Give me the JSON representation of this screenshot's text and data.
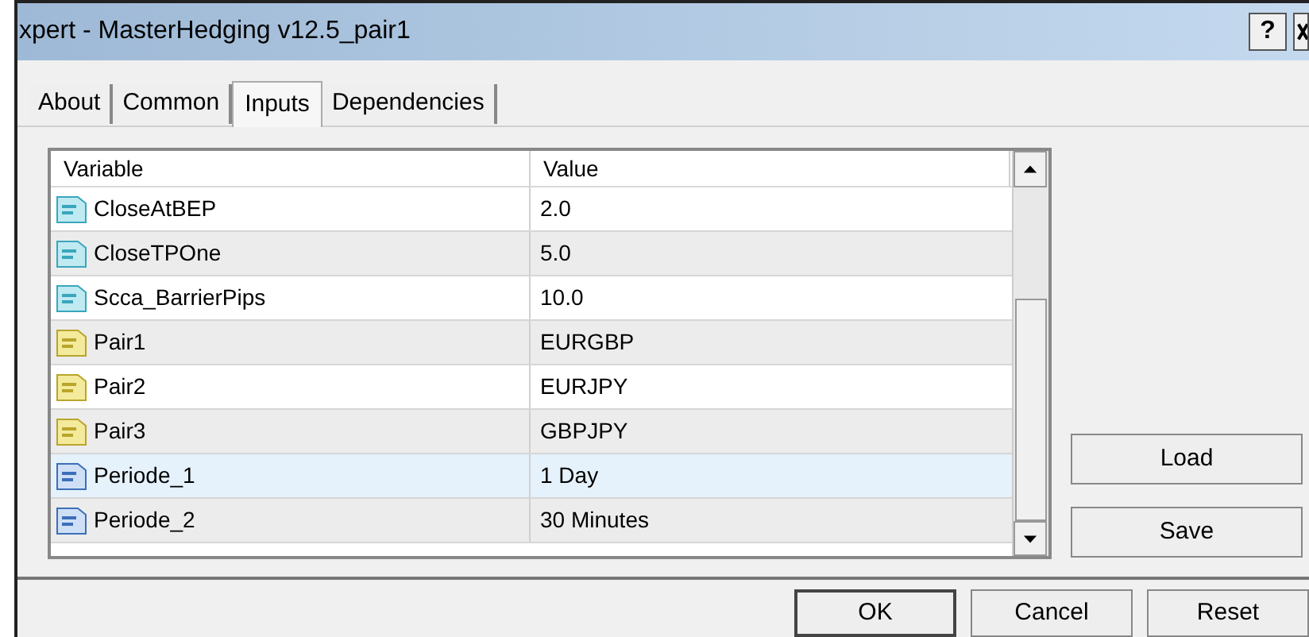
{
  "window": {
    "title": "xpert - MasterHedging v12.5_pair1",
    "help_button": "?"
  },
  "tabs": [
    {
      "label": "About",
      "selected": false
    },
    {
      "label": "Common",
      "selected": false
    },
    {
      "label": "Inputs",
      "selected": true
    },
    {
      "label": "Dependencies",
      "selected": false
    }
  ],
  "table": {
    "columns": [
      "Variable",
      "Value"
    ],
    "rows": [
      {
        "kind": "double",
        "variable": "CloseAtBEP",
        "value": "2.0",
        "selected": false
      },
      {
        "kind": "double",
        "variable": "CloseTPOne",
        "value": "5.0",
        "selected": false
      },
      {
        "kind": "double",
        "variable": "Scca_BarrierPips",
        "value": "10.0",
        "selected": false
      },
      {
        "kind": "string",
        "variable": "Pair1",
        "value": "EURGBP",
        "selected": false
      },
      {
        "kind": "string",
        "variable": "Pair2",
        "value": "EURJPY",
        "selected": false
      },
      {
        "kind": "string",
        "variable": "Pair3",
        "value": "GBPJPY",
        "selected": false
      },
      {
        "kind": "integer",
        "variable": "Periode_1",
        "value": "1 Day",
        "selected": true
      },
      {
        "kind": "integer",
        "variable": "Periode_2",
        "value": "30 Minutes",
        "selected": false
      }
    ]
  },
  "side_buttons": [
    "Load",
    "Save"
  ],
  "footer_buttons": [
    {
      "label": "OK",
      "default": true
    },
    {
      "label": "Cancel",
      "default": false
    },
    {
      "label": "Reset",
      "default": false
    }
  ]
}
